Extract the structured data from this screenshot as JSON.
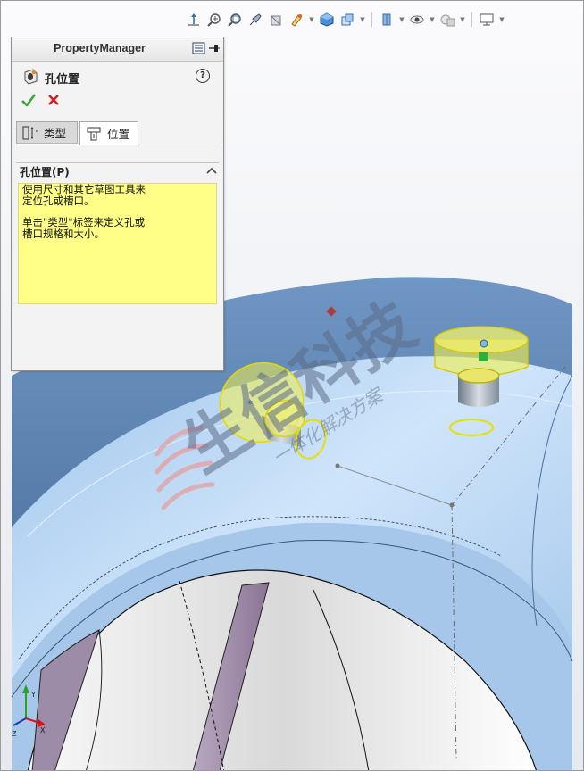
{
  "property_manager": {
    "header_title": "PropertyManager",
    "feature_title": "孔位置",
    "help_label": "?",
    "tabs": [
      {
        "label": "类型",
        "active": false
      },
      {
        "label": "位置",
        "active": true
      }
    ],
    "group": {
      "title": "孔位置(P)",
      "message_line1": "使用尺寸和其它草图工具来\n定位孔或槽口。",
      "message_line2": "单击\"类型\"标签来定义孔或\n槽口规格和大小。"
    }
  },
  "heads_up_toolbar": {
    "icons": [
      "normal-to-icon",
      "zoom-to-fit-icon",
      "zoom-to-area-icon",
      "previous-view-icon",
      "section-view-icon",
      "view-orientation-icon",
      "display-style-icon",
      "hide-show-icon",
      "edit-appearance-icon",
      "apply-scene-icon",
      "view-settings-icon",
      "display-icon"
    ]
  },
  "watermark": {
    "brand": "生信科技",
    "tagline": "一体化解决方案"
  },
  "colors": {
    "accent_ok": "#3aa53a",
    "accent_cancel": "#d01e1e",
    "arrow_red": "#e0101a",
    "highlight_yellow": "#ffff88",
    "preview_yellow": "#f2f04a",
    "part_blue": "#8eb6e0"
  }
}
